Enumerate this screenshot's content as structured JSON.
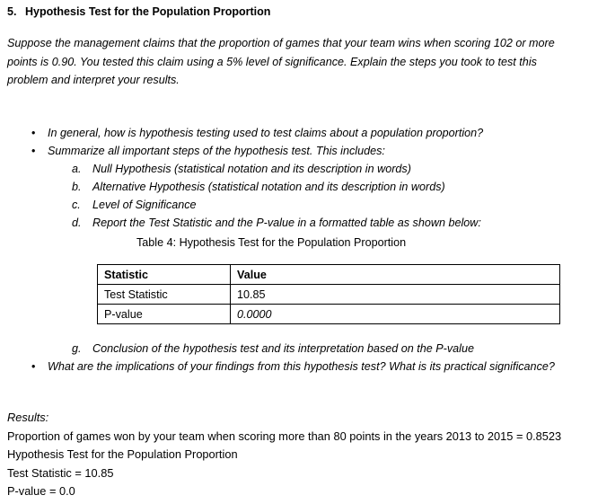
{
  "document": {
    "section": {
      "number": "5.",
      "title": "Hypothesis Test for the Population Proportion"
    },
    "intro_paragraph": "Suppose the management claims that the proportion of games that your team wins when scoring 102 or more points is 0.90. You tested this claim using a 5% level of significance. Explain the steps you took to test this problem and interpret your results.",
    "bullets": [
      {
        "marker": "•",
        "text": "In general, how is hypothesis testing used to test claims about a population proportion?"
      },
      {
        "marker": "•",
        "text": "Summarize all important steps of the hypothesis test. This includes:"
      }
    ],
    "sub_items": [
      {
        "marker": "a.",
        "text": "Null Hypothesis (statistical notation and its description in words)"
      },
      {
        "marker": "b.",
        "text": "Alternative Hypothesis (statistical notation and its description in words)"
      },
      {
        "marker": "c.",
        "text": "Level of Significance"
      },
      {
        "marker": "d.",
        "text": "Report the Test Statistic and the P-value in a formatted table as shown below:"
      }
    ],
    "table": {
      "caption": "Table 4: Hypothesis Test for the Population Proportion",
      "headers": [
        "Statistic",
        "Value"
      ],
      "rows": [
        {
          "statistic": "Test Statistic",
          "value": "10.85",
          "value_italic": false
        },
        {
          "statistic": "P-value",
          "value": "0.0000",
          "value_italic": true
        }
      ]
    },
    "post_table_items": [
      {
        "marker": "g.",
        "text": "Conclusion of the hypothesis test and its interpretation based on the P-value"
      }
    ],
    "post_table_bullets": [
      {
        "marker": "•",
        "text": "What are the implications of your findings from this hypothesis test? What is its practical significance?"
      }
    ],
    "results": {
      "label": "Results:",
      "lines": [
        "Proportion of games won by your team when scoring more than 80 points in the years 2013 to 2015 = 0.8523",
        "Hypothesis Test for the Population Proportion",
        "Test Statistic = 10.85",
        "P-value = 0.0"
      ]
    }
  }
}
